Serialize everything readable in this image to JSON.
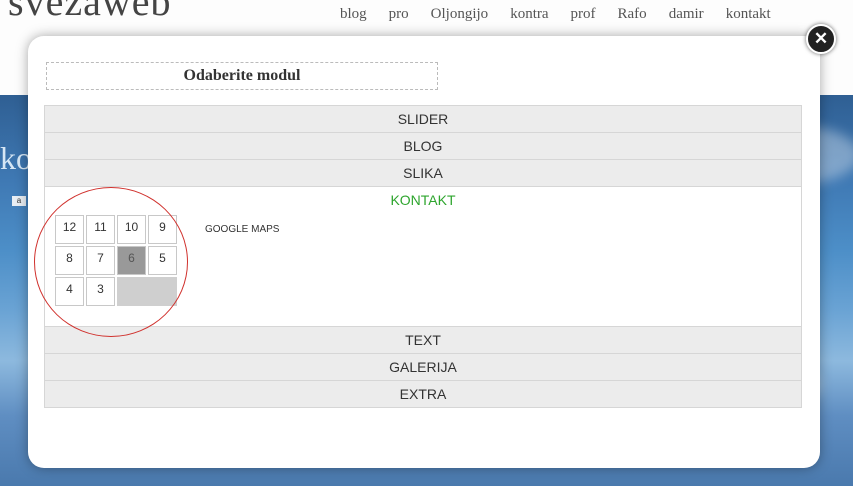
{
  "site": {
    "logo": "svezaweb",
    "nav": [
      "blog",
      "pro",
      "Oljongijo",
      "kontra",
      "prof",
      "Rafo",
      "damir",
      "kontakt"
    ],
    "side_fragment": "ko",
    "side_chip": "a"
  },
  "modal": {
    "title": "Odaberite modul",
    "close_icon": "close-icon",
    "modules_before": [
      "SLIDER",
      "BLOG",
      "SLIKA"
    ],
    "active_module": {
      "label": "KONTAKT",
      "label_color": "#2ea52e",
      "grid": [
        "12",
        "11",
        "10",
        "9",
        "8",
        "7",
        "6",
        "5",
        "4",
        "3"
      ],
      "selected_cell": "6",
      "item_label": "GOOGLE MAPS"
    },
    "modules_after": [
      "TEXT",
      "GALERIJA",
      "EXTRA"
    ]
  },
  "colors": {
    "annotation_circle": "#d0312d",
    "active_text": "#2ea52e"
  }
}
